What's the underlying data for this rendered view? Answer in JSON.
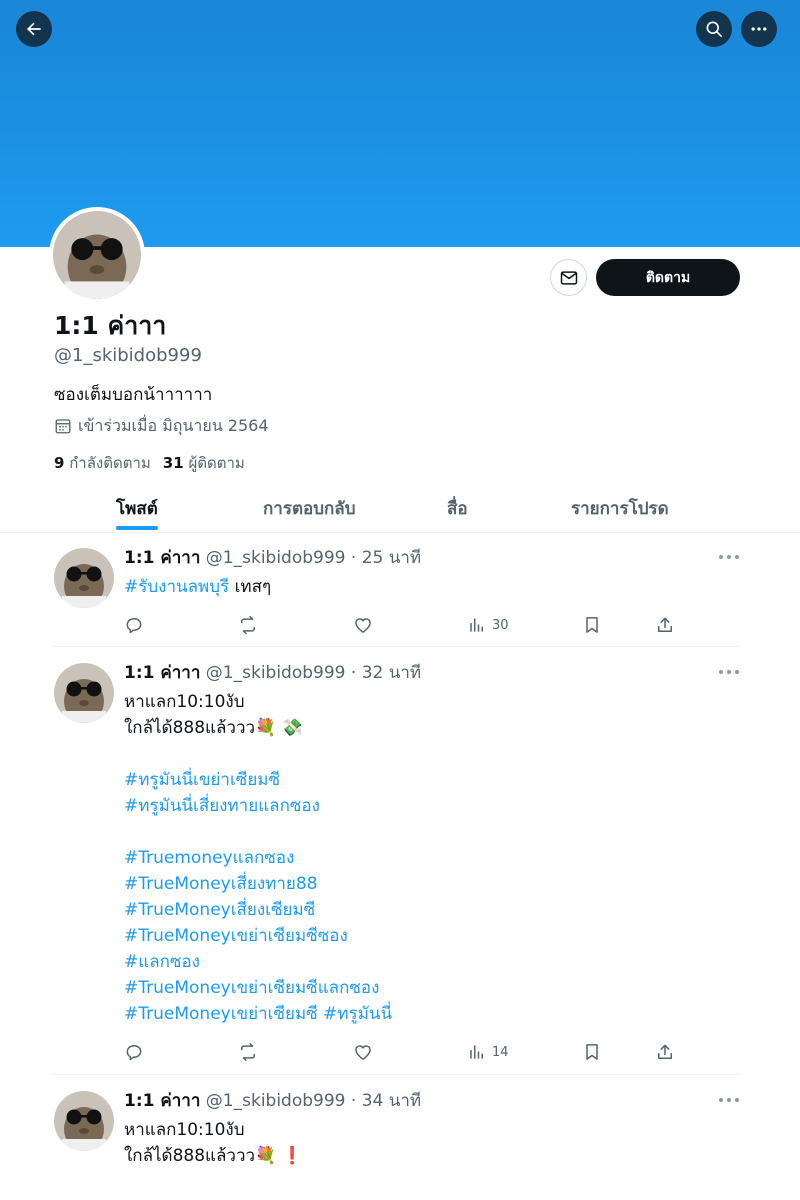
{
  "header": {
    "back_icon": "arrow-left-icon",
    "search_icon": "search-icon",
    "more_icon": "more-horizontal-icon",
    "banner_color": "#1d9bf0"
  },
  "profile": {
    "display_name": "1:1 ค่าาา",
    "handle": "@1_skibidob999",
    "bio": "ซองเต็มบอกน้าาาาาา",
    "joined": "เข้าร่วมเมื่อ มิถุนายน 2564",
    "following_count": "9",
    "following_label": "กำลังติดตาม",
    "followers_count": "31",
    "followers_label": "ผู้ติดตาม",
    "follow_button": "ติดตาม",
    "message_icon": "mail-icon"
  },
  "tabs": [
    {
      "label": "โพสต์",
      "active": true
    },
    {
      "label": "การตอบกลับ",
      "active": false
    },
    {
      "label": "สื่อ",
      "active": false
    },
    {
      "label": "รายการโปรด",
      "active": false
    }
  ],
  "posts": [
    {
      "name": "1:1 ค่าาา",
      "handle": "@1_skibidob999",
      "time": "· 25 นาที",
      "lines": [
        {
          "tag": "#รับงานลพบุรี",
          "text": " เทสๆ"
        }
      ],
      "views": "30"
    },
    {
      "name": "1:1 ค่าาา",
      "handle": "@1_skibidob999",
      "time": "· 32 นาที",
      "lines": [
        {
          "text": "หาแลก10:10งับ"
        },
        {
          "text": "ใกล้ได้888แล้ววว💐  💸"
        },
        {
          "text": ""
        },
        {
          "tag": "#ทรูมันนี่เขย่าเซียมซี"
        },
        {
          "tag": "#ทรูมันนี่เสี่ยงทายแลกซอง"
        },
        {
          "text": ""
        },
        {
          "tag": "#Truemoneyแลกซอง"
        },
        {
          "tag": "#TrueMoneyเสี่ยงทาย88"
        },
        {
          "tag": "#TrueMoneyเสี่ยงเซียมซี"
        },
        {
          "tag": "#TrueMoneyเขย่าเซียมซีซอง"
        },
        {
          "tag": "#แลกซอง"
        },
        {
          "tag": "#TrueMoneyเขย่าเซียมซีแลกซอง"
        },
        {
          "tag": "#TrueMoneyเขย่าเซียมซี #ทรูมันนี่"
        }
      ],
      "views": "14"
    },
    {
      "name": "1:1 ค่าาา",
      "handle": "@1_skibidob999",
      "time": "· 34 นาที",
      "lines": [
        {
          "text": "หาแลก10:10งับ"
        },
        {
          "text": "ใกล้ได้888แล้ววว💐 ❗"
        }
      ],
      "views": ""
    }
  ],
  "action_icons": [
    "reply-icon",
    "repost-icon",
    "like-icon",
    "views-icon",
    "bookmark-icon",
    "share-icon"
  ],
  "colors": {
    "link": "#1d9bf0",
    "text": "#0f1419",
    "muted": "#536471"
  }
}
